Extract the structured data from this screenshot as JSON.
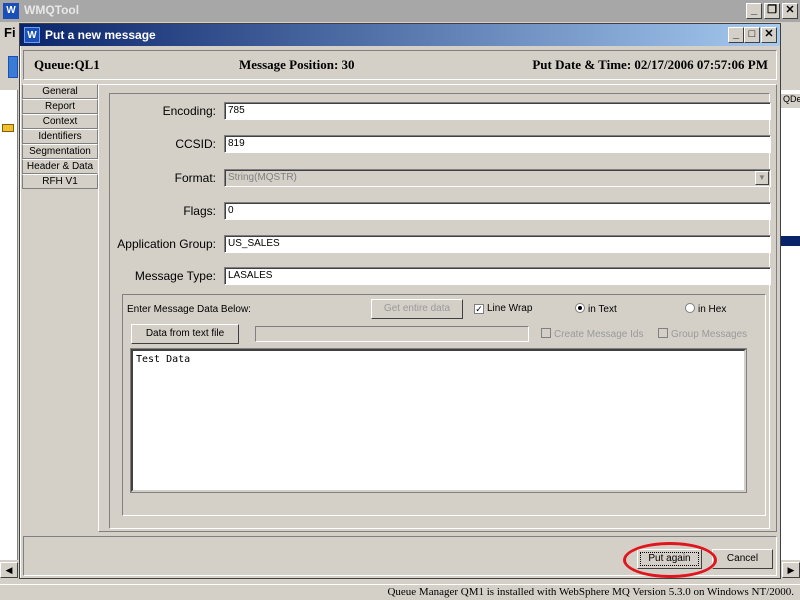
{
  "app": {
    "title": "WMQTool",
    "menu_partial": "Fi",
    "right_header_partial": "QDe",
    "status": "Queue Manager QM1  is installed with WebSphere MQ Version 5.3.0 on Windows NT/2000."
  },
  "dialog": {
    "title": "Put a new message",
    "info": {
      "queue": "Queue:QL1",
      "position": "Message Position: 30",
      "datetime": "Put Date & Time: 02/17/2006 07:57:06 PM"
    },
    "tabs": [
      {
        "label": "General"
      },
      {
        "label": "Report"
      },
      {
        "label": "Context"
      },
      {
        "label": "Identifiers"
      },
      {
        "label": "Segmentation"
      },
      {
        "label": "Header & Data"
      },
      {
        "label": "RFH V1"
      }
    ],
    "fields": {
      "encoding": {
        "label": "Encoding:",
        "value": "785"
      },
      "ccsid": {
        "label": "CCSID:",
        "value": "819"
      },
      "format": {
        "label": "Format:",
        "value": "String(MQSTR)"
      },
      "flags": {
        "label": "Flags:",
        "value": "0"
      },
      "application_group": {
        "label": "Application Group:",
        "value": "US_SALES"
      },
      "message_type": {
        "label": "Message Type:",
        "value": "LASALES"
      }
    },
    "message_data": {
      "label": "Enter Message Data Below:",
      "get_entire_data": "Get entire data",
      "line_wrap": "Line Wrap",
      "line_wrap_checked": true,
      "in_text": "in Text",
      "in_hex": "in Hex",
      "selected_mode": "text",
      "data_from_file": "Data from text file",
      "create_message_ids": "Create Message Ids",
      "group_messages": "Group Messages",
      "text": "Test Data"
    },
    "buttons": {
      "put_again": "Put again",
      "cancel": "Cancel"
    },
    "highlight_color": "#e0161f"
  }
}
